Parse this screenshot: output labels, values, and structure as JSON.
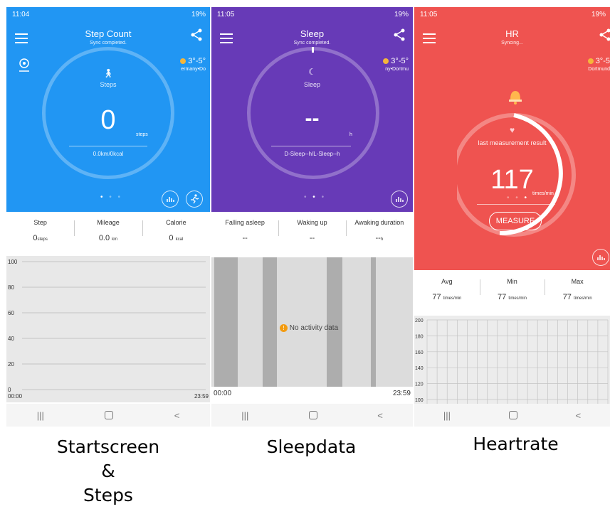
{
  "colors": {
    "steps": "#2196f3",
    "sleep": "#673ab7",
    "hr": "#ef5350"
  },
  "steps_screen": {
    "status_time": "11:04",
    "status_right": "19%",
    "title": "Step Count",
    "subtitle": "Sync completed.",
    "weather_temp": "3°-5°",
    "weather_loc": "ermany•Do",
    "ring_label": "Steps",
    "value": "0",
    "unit": "steps",
    "footer": "0.0km/0kcal",
    "stats": [
      {
        "label": "Step",
        "value": "0",
        "unit": "steps"
      },
      {
        "label": "Mileage",
        "value": "0.0",
        "unit": "km"
      },
      {
        "label": "Calorie",
        "value": "0",
        "unit": "kcal"
      }
    ],
    "chart_y_ticks": [
      "100",
      "80",
      "60",
      "40",
      "20",
      "0"
    ],
    "chart_x_start": "00:00",
    "chart_x_end": "23:59"
  },
  "sleep_screen": {
    "status_time": "11:05",
    "status_right": "19%",
    "title": "Sleep",
    "subtitle": "Sync completed.",
    "weather_temp": "3°-5°",
    "weather_loc": "ny•Dortmu",
    "ring_label": "Sleep",
    "value": "--",
    "unit": "h",
    "footer": "D-Sleep--h/L-Sleep--h",
    "stats": [
      {
        "label": "Falling asleep",
        "value": "--",
        "unit": ""
      },
      {
        "label": "Waking up",
        "value": "--",
        "unit": ""
      },
      {
        "label": "Awaking duration",
        "value": "--",
        "unit": "h"
      }
    ],
    "no_data": "No activity data",
    "chart_x_start": "00:00",
    "chart_x_end": "23:59"
  },
  "hr_screen": {
    "status_time": "11:05",
    "status_right": "19%",
    "title": "HR",
    "subtitle": "Syncing...",
    "weather_temp": "3°-5",
    "weather_loc": "Dortmund",
    "ring_label": "last measurement result",
    "value": "117",
    "unit": "times/min",
    "measure_button": "MEASURE",
    "stats": [
      {
        "label": "Avg",
        "value": "77",
        "unit": "times/min"
      },
      {
        "label": "Min",
        "value": "77",
        "unit": "times/min"
      },
      {
        "label": "Max",
        "value": "77",
        "unit": "times/min"
      }
    ],
    "chart_y_ticks": [
      "200",
      "180",
      "160",
      "140",
      "120",
      "100"
    ]
  },
  "nav_icons": [
    "recent-apps-icon",
    "home-icon",
    "back-icon"
  ],
  "captions": {
    "steps_line1": "Startscreen",
    "steps_line2": "&",
    "steps_line3": "Steps",
    "sleep": "Sleepdata",
    "hr": "Heartrate"
  }
}
